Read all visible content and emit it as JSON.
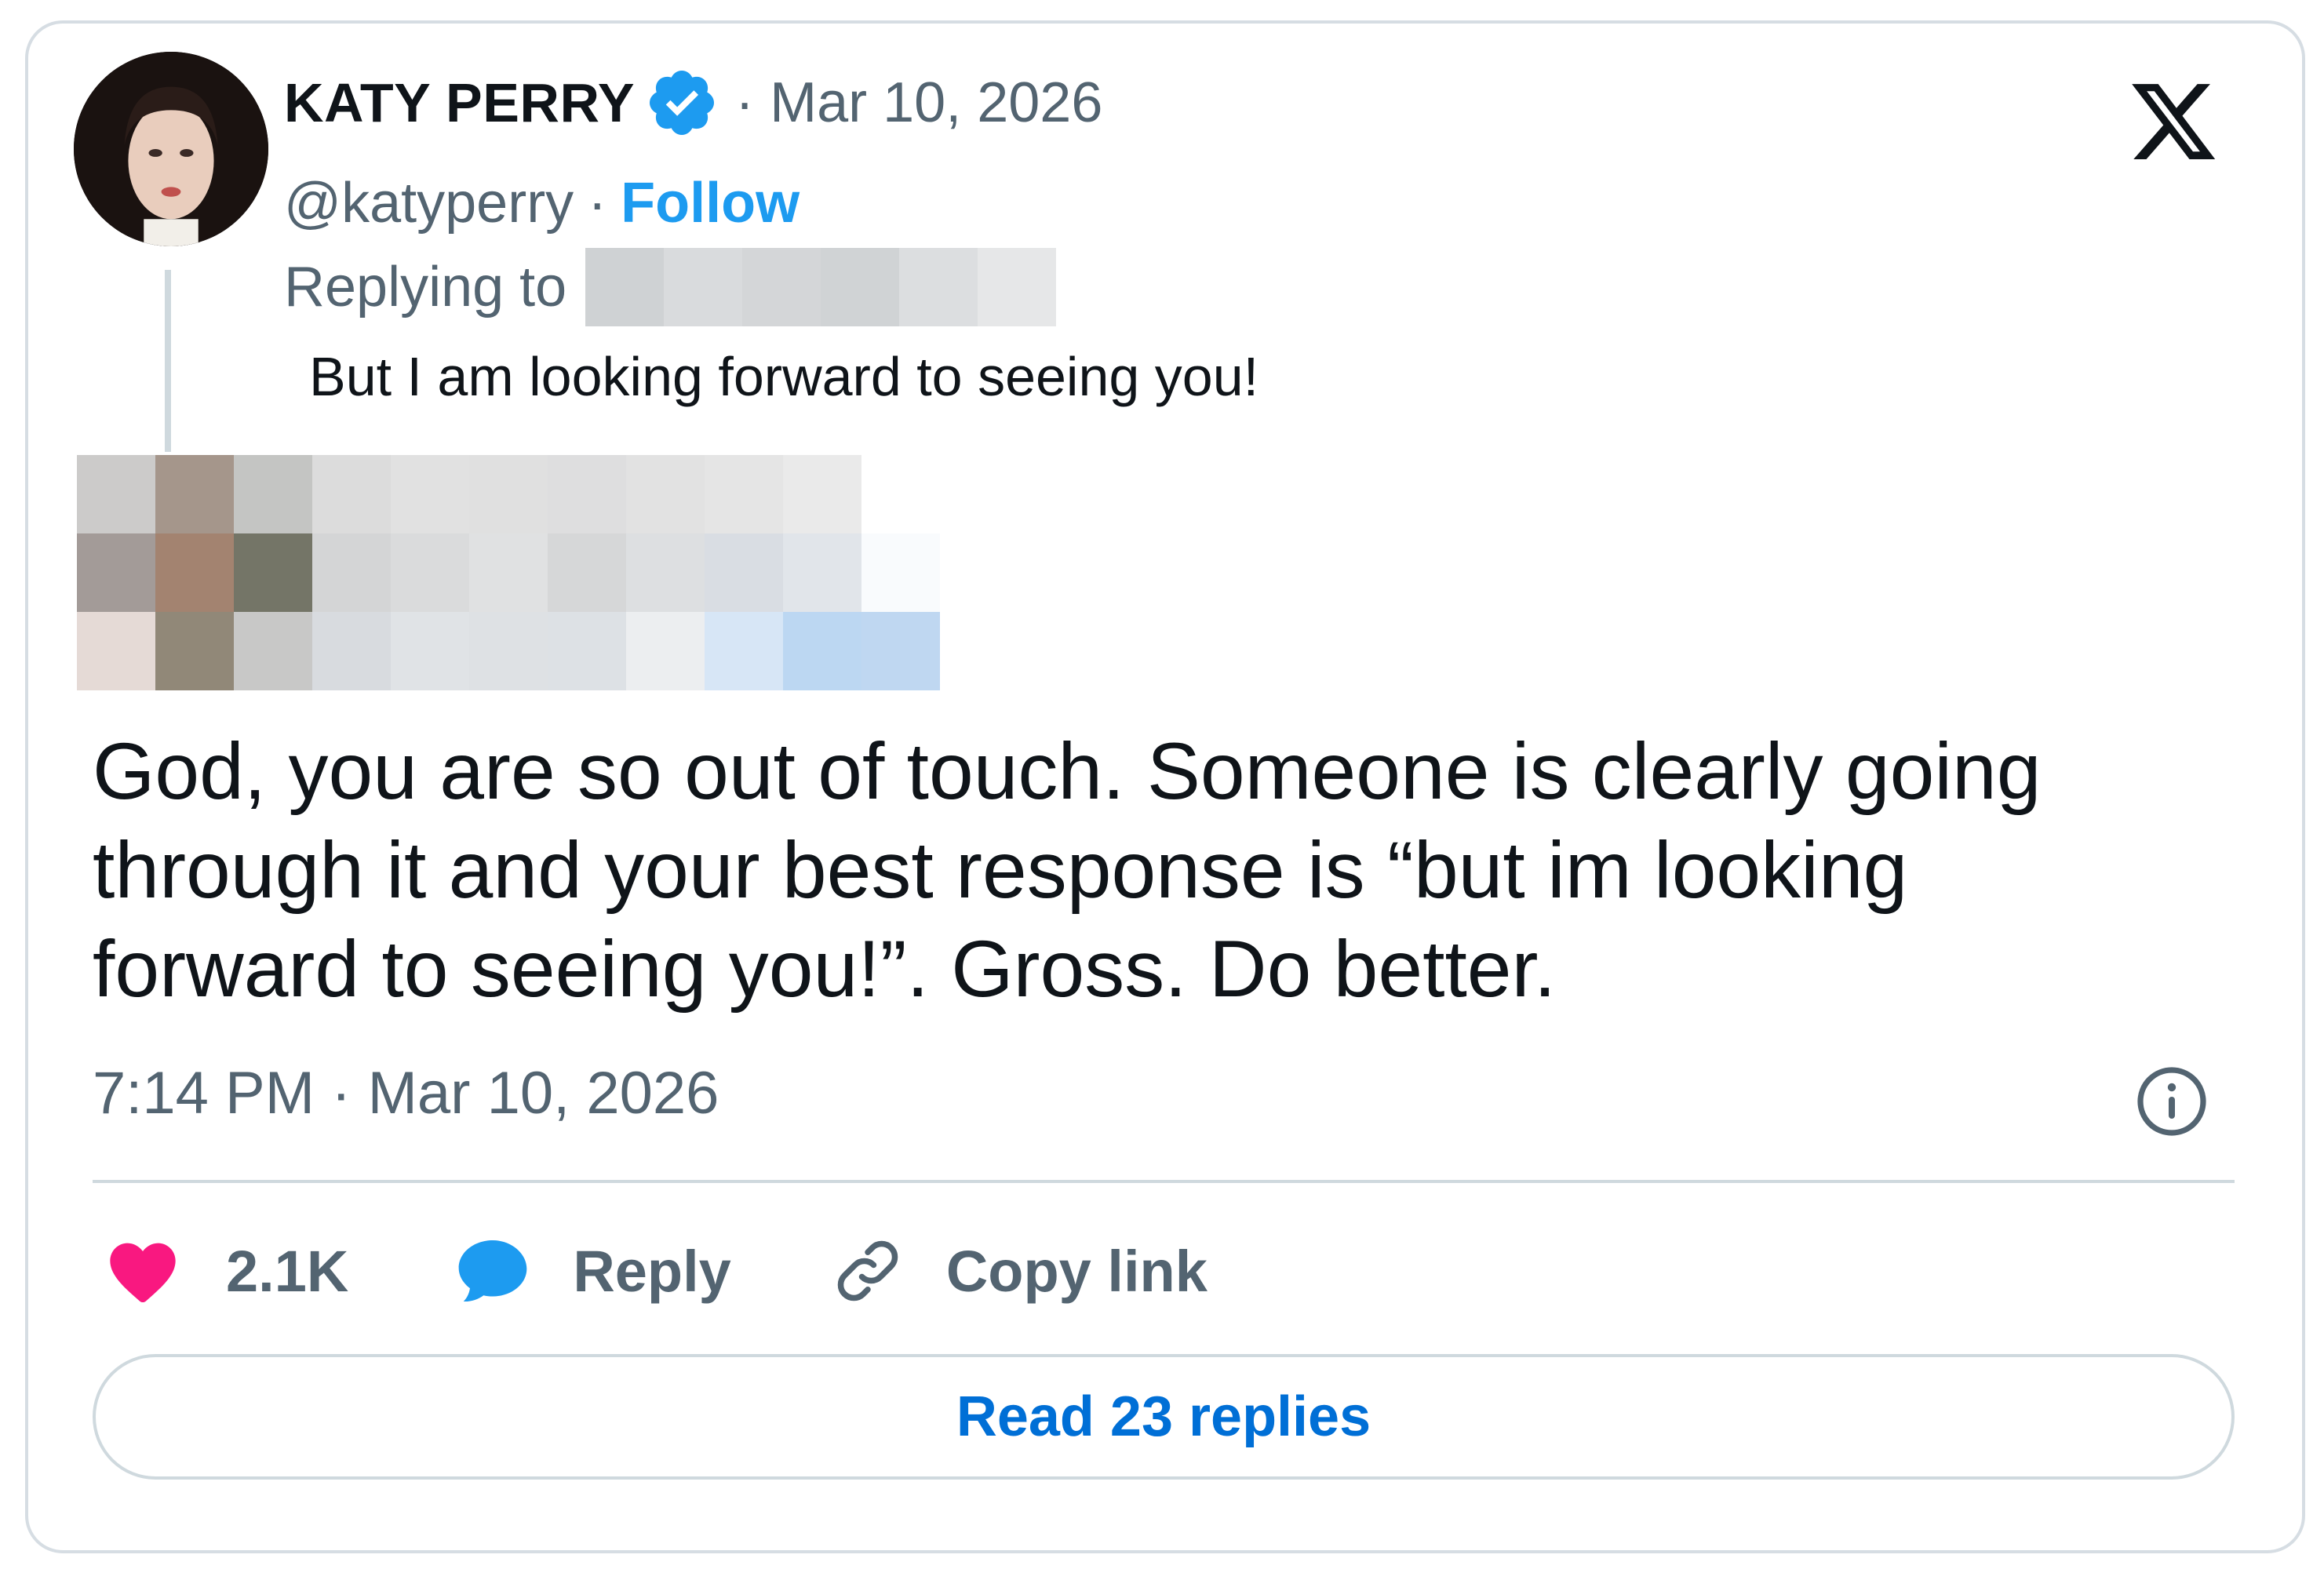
{
  "tweet": {
    "author_name": "KATY PERRY",
    "date_short": "· Mar 10, 2026",
    "handle": "@katyperry",
    "separator": "·",
    "follow_label": "Follow",
    "replying_to_label": "Replying to",
    "parent_text": "But I am looking forward to seeing you!",
    "body": "God, you are so out of touch. Someone is clearly going through it and your best response is “but im looking forward to seeing you!”. Gross. Do better.",
    "timestamp": "7:14 PM · Mar 10, 2026"
  },
  "actions": {
    "like_count": "2.1K",
    "reply_label": "Reply",
    "copy_link_label": "Copy link"
  },
  "read_replies_label": "Read 23 replies",
  "icons": {
    "brand": "x-logo-icon",
    "verified": "verified-badge-icon",
    "info": "info-icon",
    "like": "heart-icon",
    "reply": "speech-bubble-icon",
    "copy_link": "link-icon"
  },
  "colors": {
    "accent": "#1d9bf0",
    "link_text": "#006fd6",
    "like": "#f91880",
    "muted_text": "#536471",
    "main_text": "#0f1419",
    "border": "#cfd9de"
  }
}
